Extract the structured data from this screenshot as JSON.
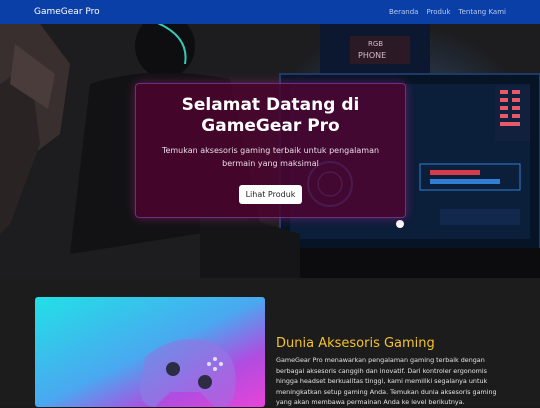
{
  "navbar": {
    "brand": "GameGear Pro",
    "links": [
      "Beranda",
      "Produk",
      "Tentang Kami"
    ]
  },
  "hero": {
    "title": "Selamat Datang di GameGear Pro",
    "subtitle": "Temukan aksesoris gaming terbaik untuk pengalaman bermain yang maksimal",
    "button_label": "Lihat Produk",
    "monitor_text": "PHONE"
  },
  "feature": {
    "title": "Dunia Aksesoris Gaming",
    "text": "GameGear Pro menawarkan pengalaman gaming terbaik dengan berbagai aksesoris canggih dan inovatif. Dari kontroler ergonomis hingga headset berkualitas tinggi, kami memiliki segalanya untuk meningkatkan setup gaming Anda. Temukan dunia aksesoris gaming yang akan membawa permainan Anda ke level berikutnya."
  },
  "colors": {
    "navbar": "#0b3fa8",
    "hero_card": "#4e0430",
    "feature_title": "#f2c230",
    "section_bg": "#1c1c1c"
  }
}
